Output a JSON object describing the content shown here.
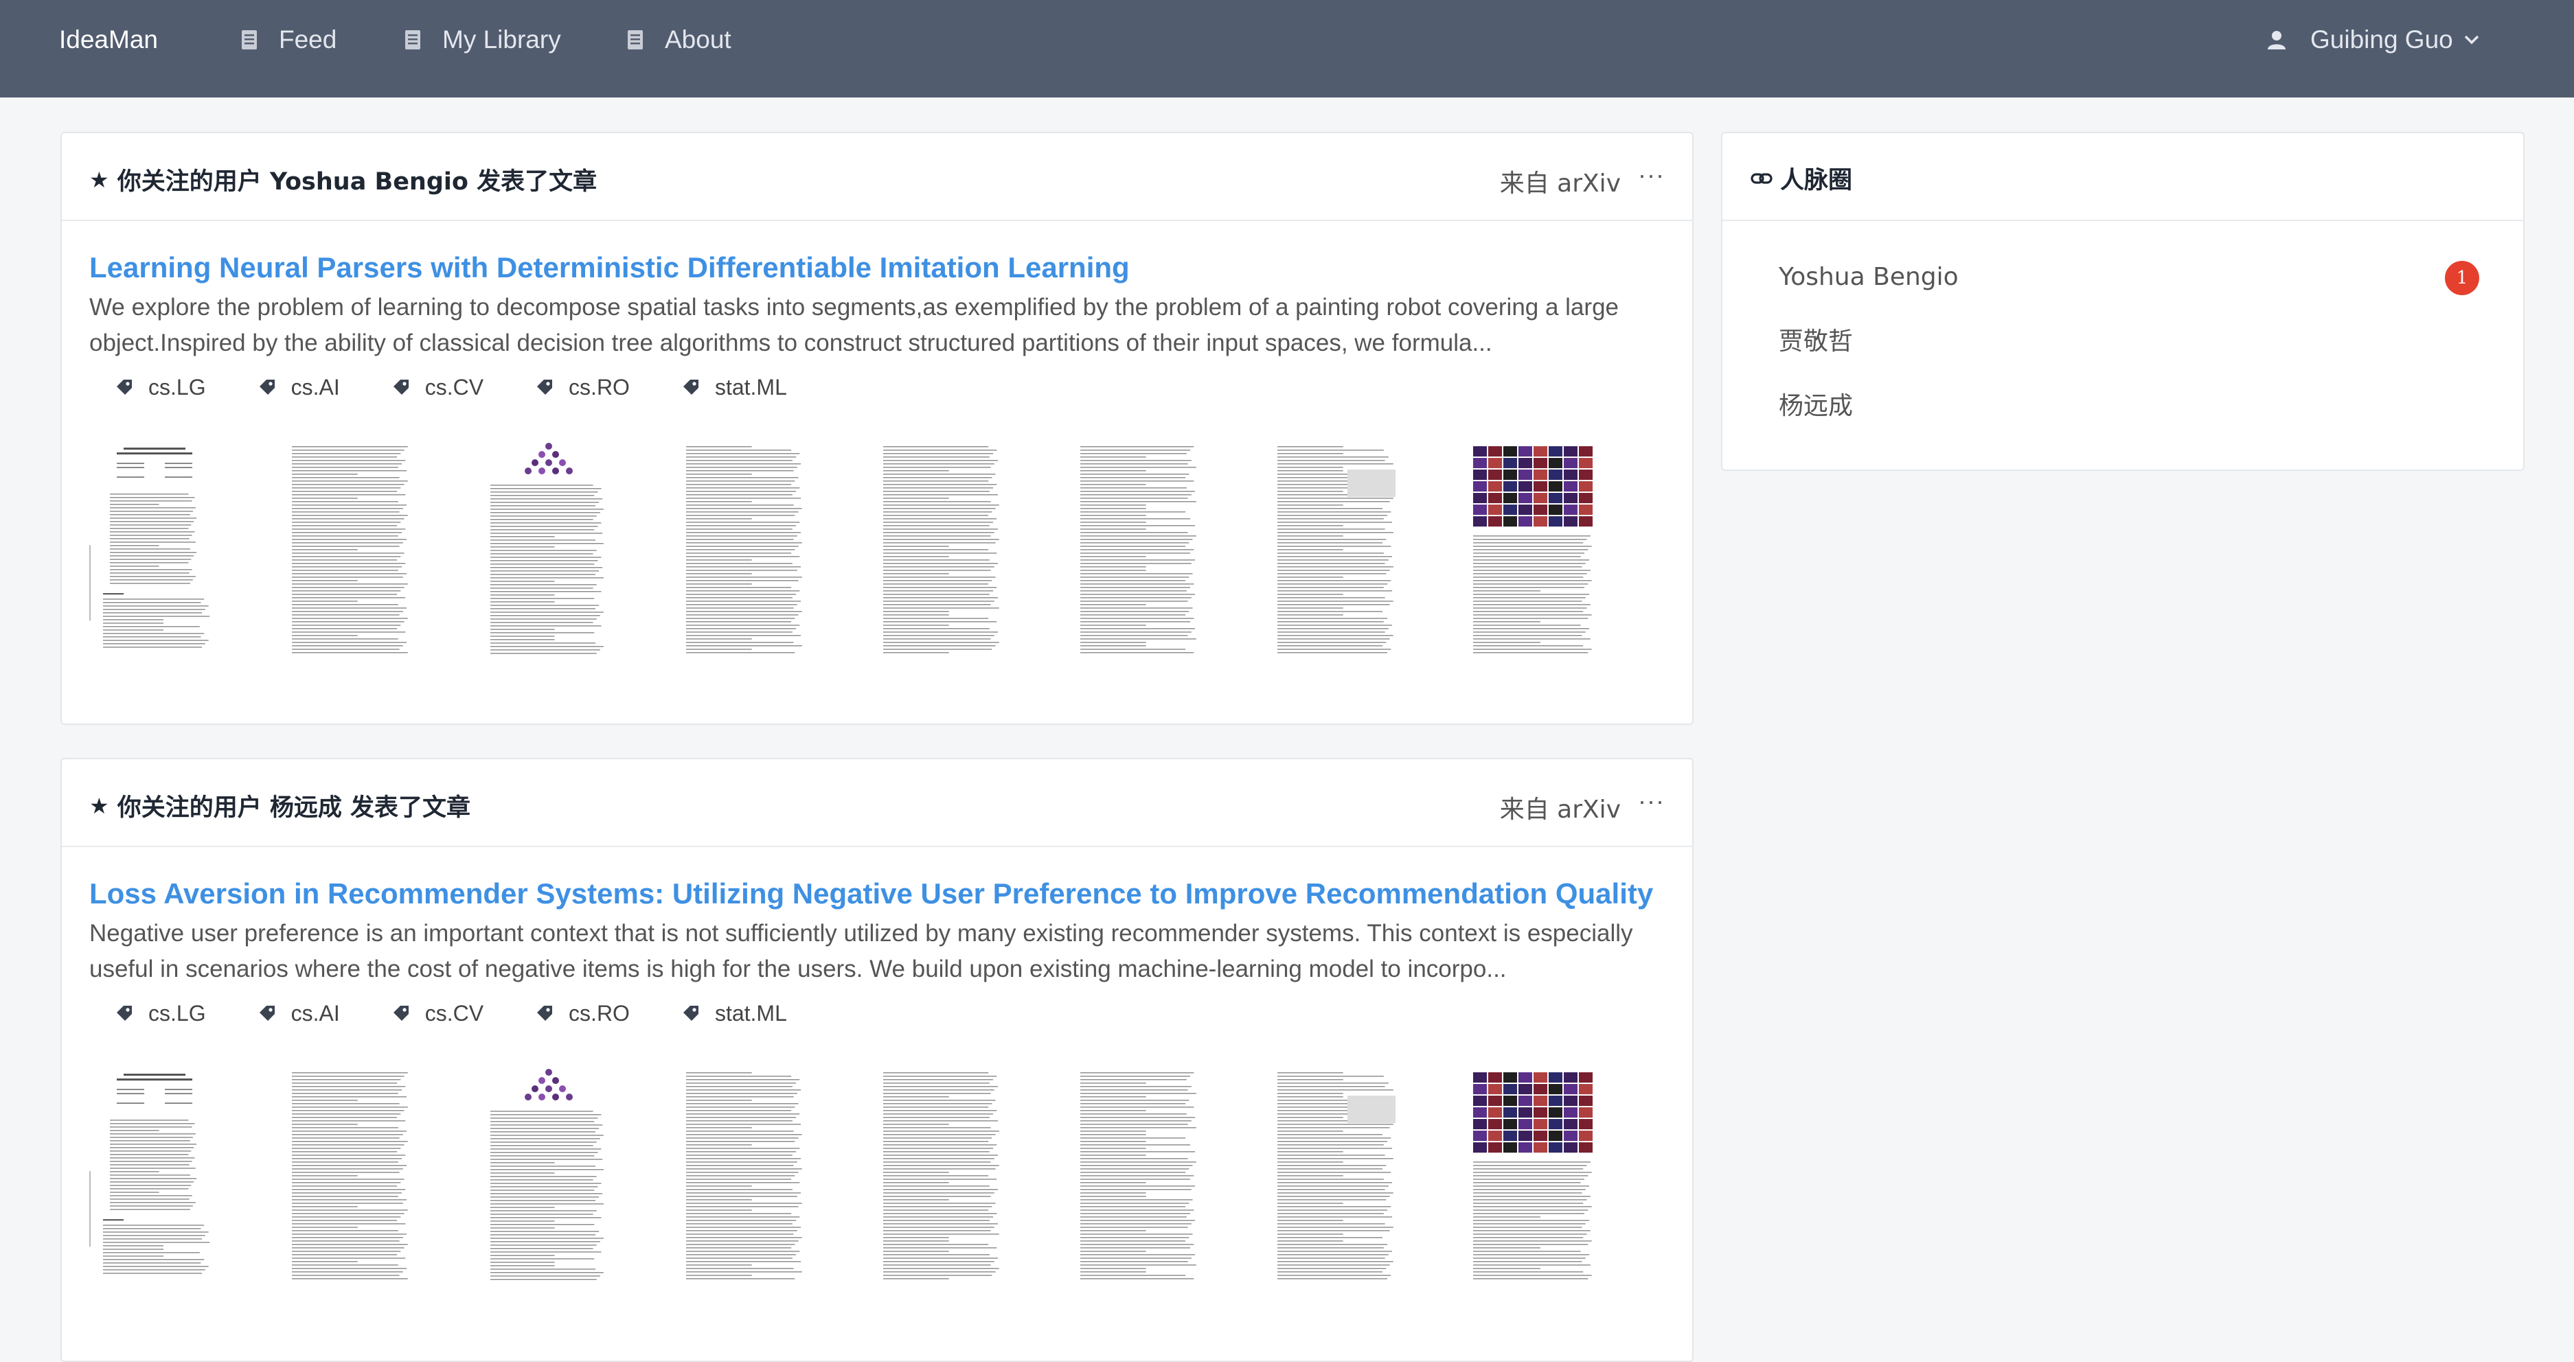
{
  "navbar": {
    "brand": "IdeaMan",
    "items": [
      {
        "label": "Feed",
        "icon": "document-icon"
      },
      {
        "label": "My Library",
        "icon": "document-icon"
      },
      {
        "label": "About",
        "icon": "document-icon"
      }
    ],
    "user": {
      "name": "Guibing Guo",
      "icon": "user-icon"
    }
  },
  "feed": [
    {
      "header": "你关注的用户 Yoshua Bengio 发表了文章",
      "source": "来自 arXiv",
      "more": "···",
      "title": "Learning Neural Parsers with Deterministic Differentiable Imitation Learning",
      "abstract_line1": "We explore the problem of learning to decompose spatial tasks into segments,as exemplified by the problem of a painting robot covering a large",
      "abstract_line2": "object.Inspired by the ability of classical decision tree algorithms to construct structured partitions of their input spaces, we formula...",
      "tags": [
        "cs.LG",
        "cs.AI",
        "cs.CV",
        "cs.RO",
        "stat.ML"
      ]
    },
    {
      "header": "你关注的用户 杨远成 发表了文章",
      "source": "来自 arXiv",
      "more": "···",
      "title": "Loss Aversion in Recommender Systems: Utilizing Negative User Preference to Improve Recommendation Quality",
      "abstract_line1": "Negative user preference is an important context that is not sufficiently utilized by many existing recommender systems. This context is especially",
      "abstract_line2": "useful in scenarios where the cost of negative items is high for the users. We build upon existing machine-learning model to incorpo...",
      "tags": [
        "cs.LG",
        "cs.AI",
        "cs.CV",
        "cs.RO",
        "stat.ML"
      ]
    }
  ],
  "sidebar": {
    "title": "人脉圈",
    "icon": "link-icon",
    "contacts": [
      {
        "name": "Yoshua Bengio",
        "badge": "1"
      },
      {
        "name": "贾敬哲"
      },
      {
        "name": "杨远成"
      }
    ]
  },
  "colors": {
    "navbar_bg": "#525c6f",
    "link_blue": "#3e90e3",
    "badge_red": "#e5402e"
  }
}
